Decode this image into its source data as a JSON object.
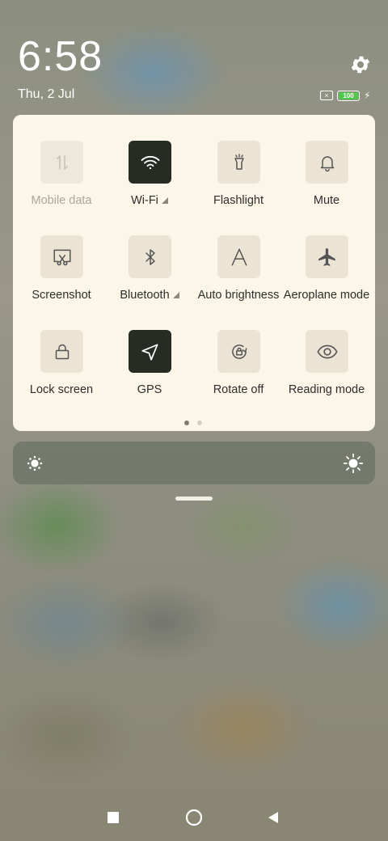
{
  "status": {
    "time": "6:58",
    "date": "Thu, 2 Jul",
    "battery": "100",
    "battery_color": "#4ec94e"
  },
  "quick_settings": {
    "tiles": [
      {
        "label": "Mobile data",
        "icon": "mobile-data-icon",
        "state": "disabled"
      },
      {
        "label": "Wi-Fi",
        "icon": "wifi-icon",
        "state": "on",
        "has_menu": true
      },
      {
        "label": "Flashlight",
        "icon": "flashlight-icon",
        "state": "off"
      },
      {
        "label": "Mute",
        "icon": "bell-icon",
        "state": "off"
      },
      {
        "label": "Screenshot",
        "icon": "screenshot-icon",
        "state": "off"
      },
      {
        "label": "Bluetooth",
        "icon": "bluetooth-icon",
        "state": "off",
        "has_menu": true
      },
      {
        "label": "Auto brightness",
        "icon": "auto-brightness-icon",
        "state": "off"
      },
      {
        "label": "Aeroplane mode",
        "icon": "airplane-icon",
        "state": "off"
      },
      {
        "label": "Lock screen",
        "icon": "lock-icon",
        "state": "off"
      },
      {
        "label": "GPS",
        "icon": "location-arrow-icon",
        "state": "on"
      },
      {
        "label": "Rotate off",
        "icon": "rotate-lock-icon",
        "state": "off"
      },
      {
        "label": "Reading mode",
        "icon": "eye-icon",
        "state": "off"
      }
    ],
    "page_count": 2,
    "current_page": 1
  },
  "brightness": {
    "low_icon": "brightness-low-icon",
    "high_icon": "brightness-high-icon"
  },
  "colors": {
    "active_tile": "#262c24",
    "inactive_tile": "#ebe4d5",
    "panel": "#fcf6e8"
  }
}
